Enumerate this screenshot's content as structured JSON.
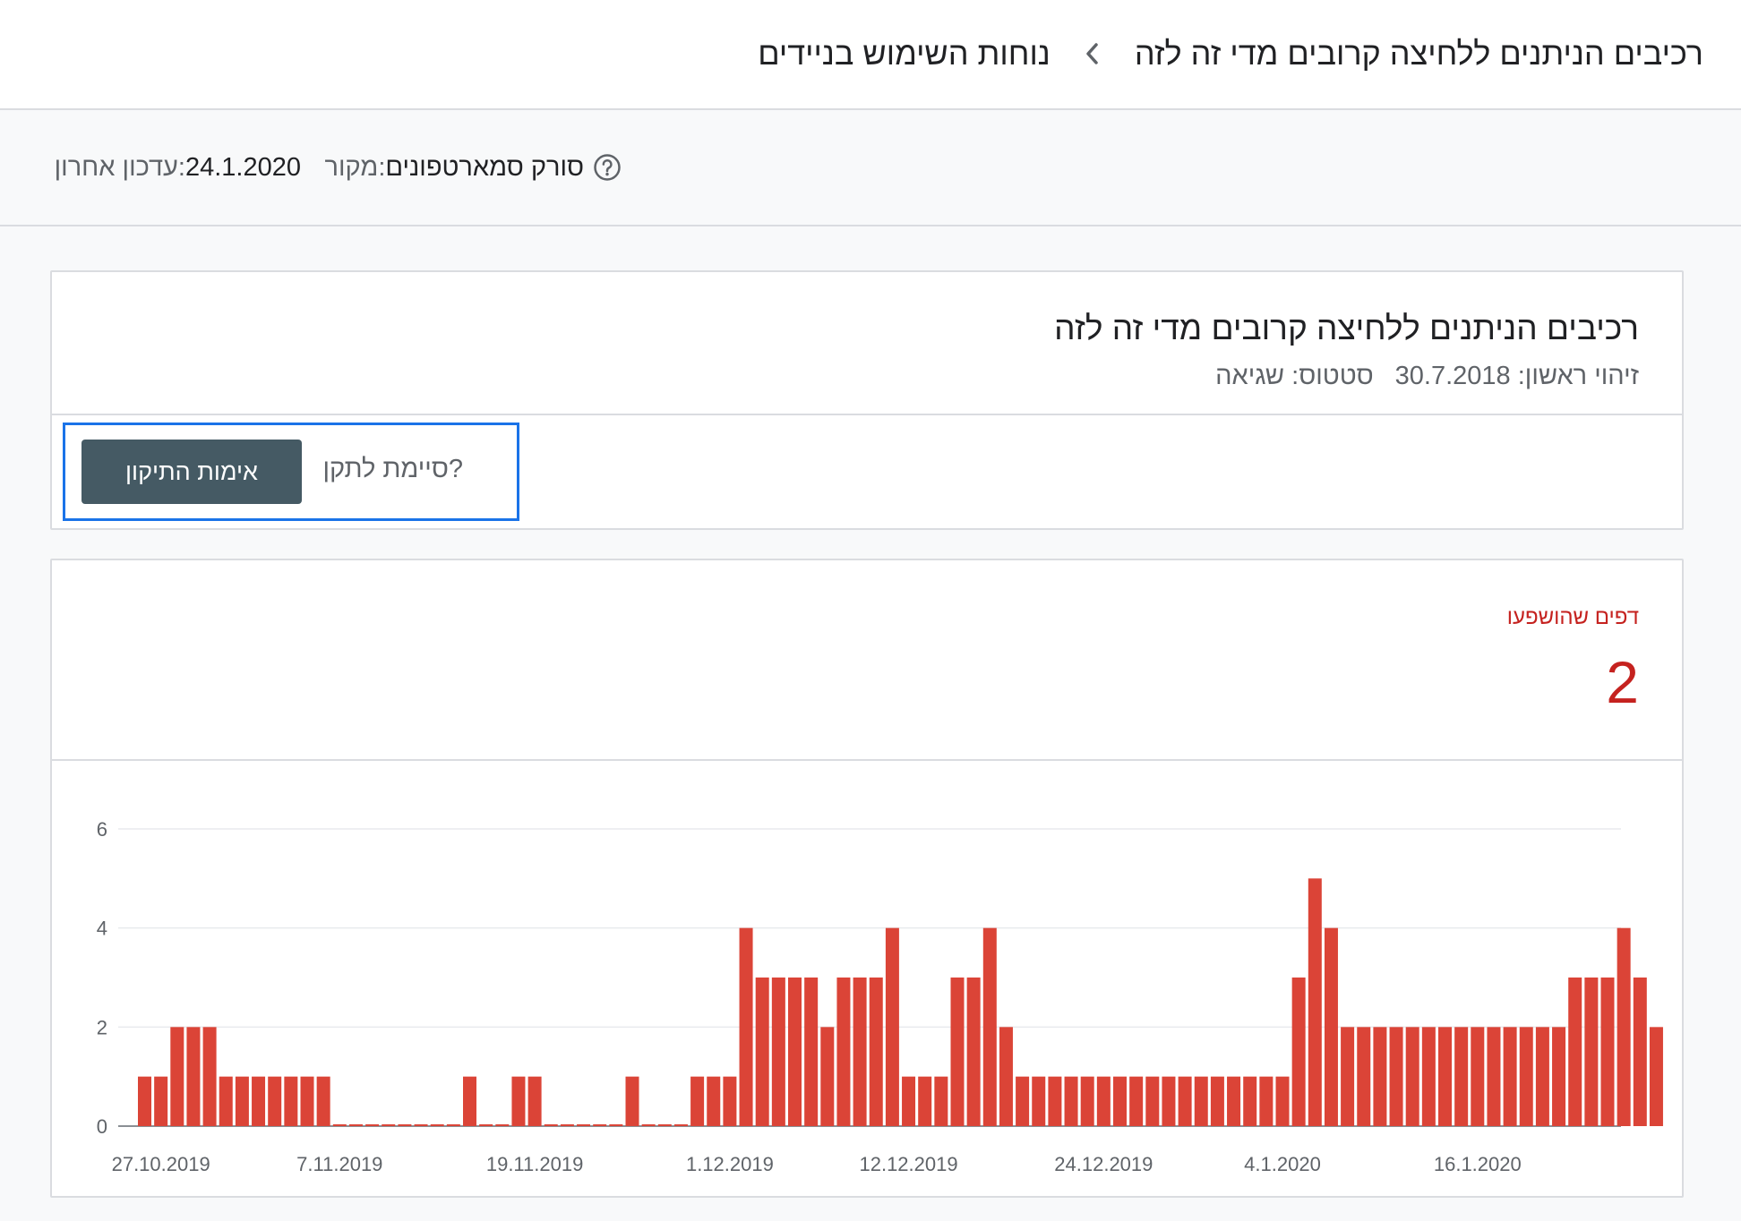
{
  "breadcrumb": {
    "root": "נוחות השימוש בניידים",
    "current": "רכיבים הניתנים ללחיצה קרובים מדי זה לזה",
    "separator_icon": "chevron-right-icon"
  },
  "info_bar": {
    "source_label": "מקור:",
    "source_value": "סורק סמארטפונים",
    "help_icon": "help-circle-icon",
    "updated_label": "עדכון אחרון:",
    "updated_value": "24.1.2020"
  },
  "issue": {
    "title": "רכיבים הניתנים ללחיצה קרובים מדי זה לזה",
    "first_detected_label": "זיהוי ראשון:",
    "first_detected_value": "30.7.2018",
    "status_label": "סטטוס:",
    "status_value": "שגיאה",
    "fix_question": "סיימת לתקן?",
    "validate_button": "אימות התיקון"
  },
  "metric": {
    "label": "דפים שהושפעו",
    "value": "2"
  },
  "colors": {
    "bar": "#db4437",
    "accent_red": "#c5221f",
    "focus_blue": "#1a73e8",
    "button_bg": "#455a64"
  },
  "chart_data": {
    "type": "bar",
    "x_start": "26.10.2019",
    "x_end": "24.1.2020",
    "x_tick_labels": [
      "27.10.2019",
      "7.11.2019",
      "19.11.2019",
      "1.12.2019",
      "12.12.2019",
      "24.12.2019",
      "4.1.2020",
      "16.1.2020"
    ],
    "x_tick_dates": [
      "2019-10-27",
      "2019-11-07",
      "2019-11-19",
      "2019-12-01",
      "2019-12-12",
      "2019-12-24",
      "2020-01-04",
      "2020-01-16"
    ],
    "yticks": [
      0,
      2,
      4,
      6
    ],
    "ylim": [
      0,
      6
    ],
    "grid": true,
    "values": [
      1,
      1,
      2,
      2,
      2,
      1,
      1,
      1,
      1,
      1,
      1,
      1,
      0,
      0,
      0,
      0,
      0,
      0,
      0,
      0,
      1,
      0,
      0,
      1,
      1,
      0,
      0,
      0,
      0,
      0,
      1,
      0,
      0,
      0,
      1,
      1,
      1,
      4,
      3,
      3,
      3,
      3,
      2,
      3,
      3,
      3,
      4,
      1,
      1,
      1,
      3,
      3,
      4,
      2,
      1,
      1,
      1,
      1,
      1,
      1,
      1,
      1,
      1,
      1,
      1,
      1,
      1,
      1,
      1,
      1,
      1,
      3,
      5,
      4,
      2,
      2,
      2,
      2,
      2,
      2,
      2,
      2,
      2,
      2,
      2,
      2,
      2,
      2,
      3,
      3,
      3,
      4,
      3,
      2
    ]
  }
}
